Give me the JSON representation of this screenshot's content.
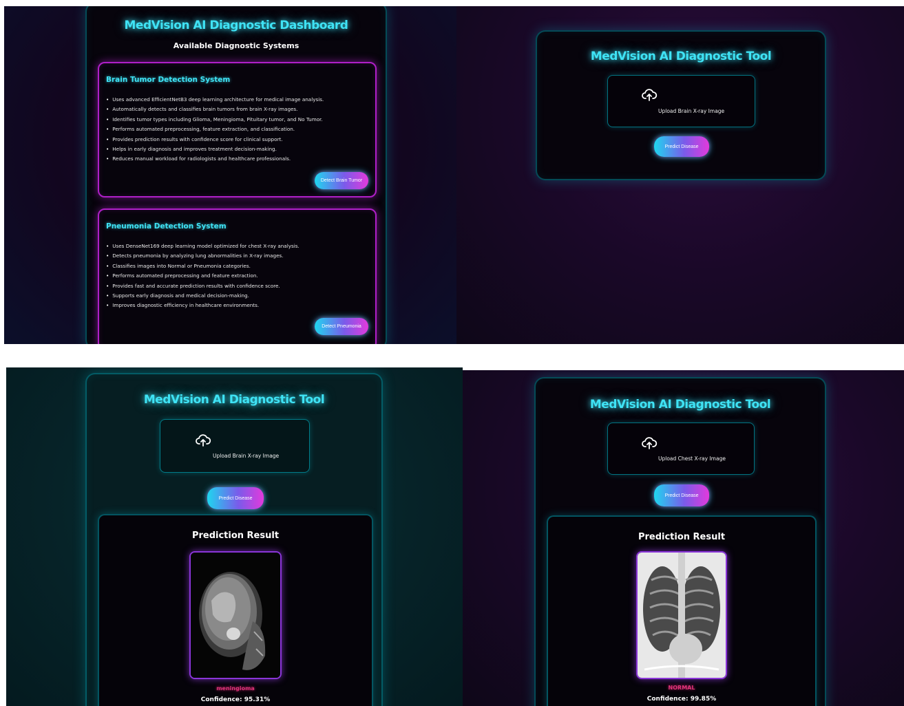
{
  "dashboard": {
    "title": "MedVision AI Diagnostic Dashboard",
    "subtitle": "Available Diagnostic Systems",
    "brain_card": {
      "title": "Brain Tumor Detection System",
      "features": [
        "Uses advanced EfficientNetB3 deep learning architecture for medical image analysis.",
        "Automatically detects and classifies brain tumors from brain X-ray images.",
        "Identifies tumor types including Glioma, Meningioma, Pituitary tumor, and No Tumor.",
        "Performs automated preprocessing, feature extraction, and classification.",
        "Provides prediction results with confidence score for clinical support.",
        "Helps in early diagnosis and improves treatment decision-making.",
        "Reduces manual workload for radiologists and healthcare professionals."
      ],
      "button": "Detect Brain Tumor"
    },
    "pneumonia_card": {
      "title": "Pneumonia Detection System",
      "features": [
        "Uses DenseNet169 deep learning model optimized for chest X-ray analysis.",
        "Detects pneumonia by analyzing lung abnormalities in X-ray images.",
        "Classifies images into Normal or Pneumonia categories.",
        "Performs automated preprocessing and feature extraction.",
        "Provides fast and accurate prediction results with confidence score.",
        "Supports early diagnosis and medical decision-making.",
        "Improves diagnostic efficiency in healthcare environments."
      ],
      "button": "Detect Pneumonia"
    }
  },
  "tool_upload": {
    "title": "MedVision AI Diagnostic Tool",
    "upload_label": "Upload Brain X-ray Image",
    "button": "Predict Disease"
  },
  "tool_brain_result": {
    "title": "MedVision AI Diagnostic Tool",
    "upload_label": "Upload Brain X-ray Image",
    "button": "Predict Disease",
    "result_title": "Prediction Result",
    "prediction": "meningioma",
    "confidence": "Confidence: 95.31%"
  },
  "tool_chest_result": {
    "title": "MedVision AI Diagnostic Tool",
    "upload_label": "Upload Chest X-ray Image",
    "button": "Predict Disease",
    "result_title": "Prediction Result",
    "prediction": "NORMAL",
    "confidence": "Confidence: 99.85%"
  },
  "icons": {
    "upload": "cloud-upload-icon"
  },
  "colors": {
    "accent_cyan": "#3fe3f5",
    "accent_magenta": "#b01fc8",
    "prediction_pink": "#e0337a"
  }
}
